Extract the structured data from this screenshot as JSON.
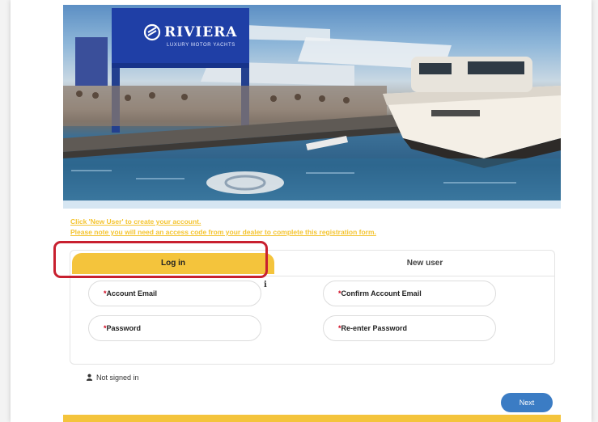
{
  "hero": {
    "brand_name": "RIVIERA",
    "brand_tagline": "LUXURY MOTOR YACHTS"
  },
  "notice": {
    "line1": "Click 'New User' to create your account.",
    "line2": "Please note you will need an access code from your dealer to complete this registration form."
  },
  "tabs": {
    "login_label": "Log in",
    "new_user_label": "New user"
  },
  "form": {
    "required_marker": "*",
    "account_email_label": "Account Email",
    "password_label": "Password",
    "confirm_email_label": "Confirm Account Email",
    "reenter_password_label": "Re-enter Password",
    "info_icon": "i"
  },
  "status": {
    "text": "Not signed in",
    "icon": "person-icon"
  },
  "actions": {
    "next_label": "Next"
  },
  "colors": {
    "accent_yellow": "#f4c43c",
    "highlight_red": "#c8202f",
    "button_blue": "#3b7cc4",
    "required_red": "#d0021b"
  }
}
